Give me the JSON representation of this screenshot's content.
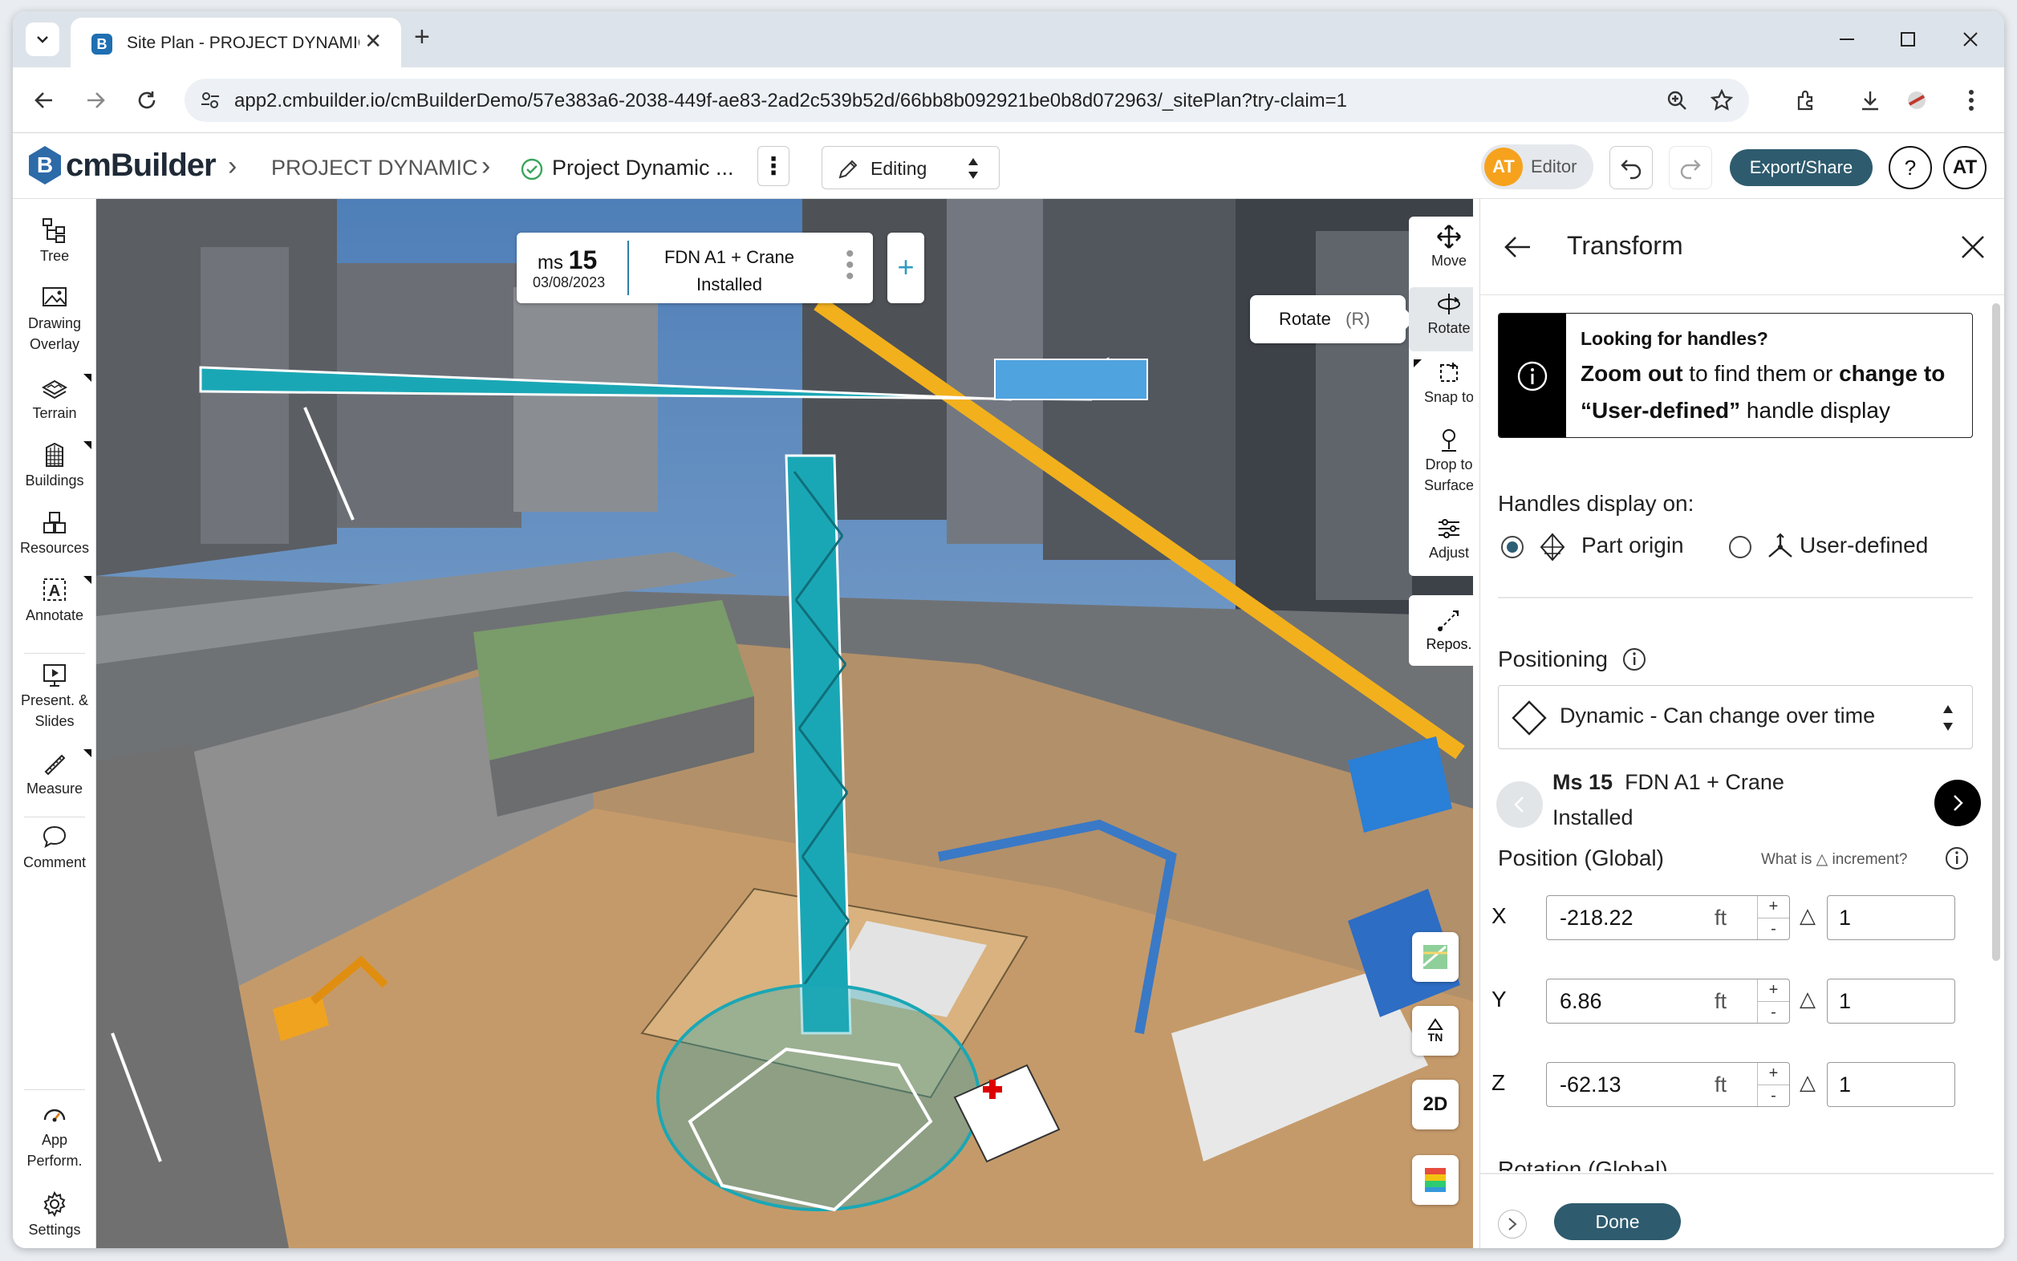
{
  "browser": {
    "tab_title": "Site Plan - PROJECT DYNAMIC",
    "url": "app2.cmbuilder.io/cmBuilderDemo/57e383a6-2038-449f-ae83-2ad2c539b52d/66bb8b092921be0b8d072963/_sitePlan?try-claim=1"
  },
  "header": {
    "logo_text": "cmBuilder",
    "breadcrumb_project": "PROJECT DYNAMIC",
    "breadcrumb_plan": "Project Dynamic ...",
    "mode": "Editing",
    "user_initials": "AT",
    "role": "Editor",
    "export_label": "Export/Share",
    "help_label": "?",
    "account_initials": "AT"
  },
  "sidebar": {
    "items": [
      {
        "label": "Tree",
        "icon": "tree-icon"
      },
      {
        "label": "Drawing Overlay",
        "icon": "image-icon"
      },
      {
        "label": "Terrain",
        "icon": "terrain-icon"
      },
      {
        "label": "Buildings",
        "icon": "building-icon"
      },
      {
        "label": "Resources",
        "icon": "resources-icon"
      },
      {
        "label": "Annotate",
        "icon": "annotate-icon"
      },
      {
        "label": "Present. & Slides",
        "icon": "presentation-icon"
      },
      {
        "label": "Measure",
        "icon": "ruler-icon"
      },
      {
        "label": "Comment",
        "icon": "comment-icon"
      },
      {
        "label": "App Perform.",
        "icon": "gauge-icon"
      },
      {
        "label": "Settings",
        "icon": "gear-icon"
      }
    ]
  },
  "milestone": {
    "ms_prefix": "ms",
    "ms_number": "15",
    "date": "03/08/2023",
    "name": "FDN A1 + Crane",
    "status": "Installed"
  },
  "tooltip": {
    "label": "Rotate",
    "key": "(R)"
  },
  "tools": {
    "move": "Move",
    "rotate": "Rotate",
    "snap": "Snap to",
    "drop": "Drop to Surface",
    "adjust": "Adjust",
    "repos": "Repos."
  },
  "view_buttons": {
    "north": "TN",
    "mode": "2D"
  },
  "panel": {
    "title": "Transform",
    "info_title": "Looking for handles?",
    "info_part1": "Zoom out",
    "info_part2": " to find them or ",
    "info_part3": "change to",
    "info_part4": "“User-defined”",
    "info_part5": " handle display",
    "handles_label": "Handles display on:",
    "handle_options": [
      "Part origin",
      "User-defined"
    ],
    "handle_selected": "Part origin",
    "positioning_label": "Positioning",
    "positioning_value": "Dynamic - Can change over time",
    "ms_label": "Ms 15",
    "ms_name": "FDN A1 + Crane",
    "ms_status": "Installed",
    "position_label": "Position (Global)",
    "increment_help": "What is △ increment?",
    "unit": "ft",
    "coords": [
      {
        "axis": "X",
        "value": "-218.22",
        "increment": "1"
      },
      {
        "axis": "Y",
        "value": "6.86",
        "increment": "1"
      },
      {
        "axis": "Z",
        "value": "-62.13",
        "increment": "1"
      }
    ],
    "rotation_label": "Rotation (Global)",
    "done_label": "Done"
  }
}
